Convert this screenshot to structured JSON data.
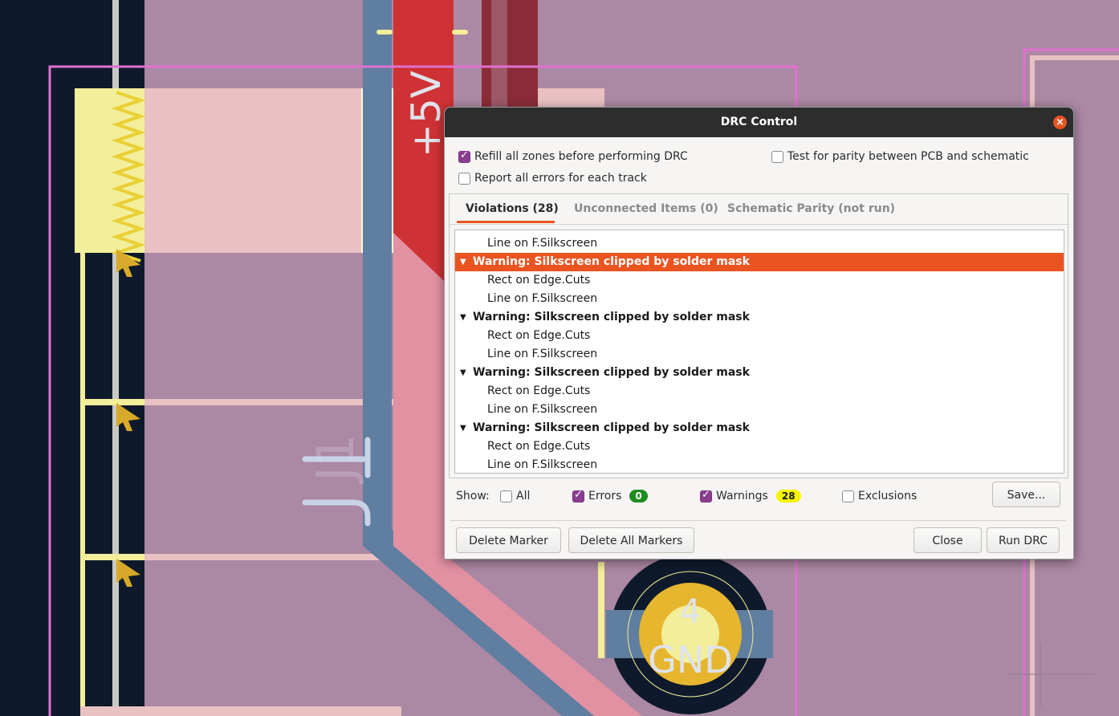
{
  "pcb": {
    "net_label_top": "+5V",
    "ref_label": "J1",
    "pad_number": "4",
    "pad_net": "GND"
  },
  "dialog": {
    "title": "DRC Control",
    "options": {
      "refill_zones": "Refill all zones before performing DRC",
      "report_all_errors": "Report all errors for each track",
      "test_parity": "Test for parity between PCB and schematic"
    },
    "tabs": [
      "Violations (28)",
      "Unconnected Items (0)",
      "Schematic Parity (not run)"
    ],
    "list": {
      "partial_top": "Line on F.Silkscreen",
      "items": [
        {
          "title": "Warning: Silkscreen clipped by solder mask",
          "children": [
            "Rect on Edge.Cuts",
            "Line on F.Silkscreen"
          ]
        },
        {
          "title": "Warning: Silkscreen clipped by solder mask",
          "children": [
            "Rect on Edge.Cuts",
            "Line on F.Silkscreen"
          ]
        },
        {
          "title": "Warning: Silkscreen clipped by solder mask",
          "children": [
            "Rect on Edge.Cuts",
            "Line on F.Silkscreen"
          ]
        },
        {
          "title": "Warning: Silkscreen clipped by solder mask",
          "children": [
            "Rect on Edge.Cuts",
            "Line on F.Silkscreen"
          ]
        }
      ]
    },
    "show": {
      "label": "Show:",
      "all": "All",
      "errors": "Errors",
      "errors_count": "0",
      "warnings": "Warnings",
      "warnings_count": "28",
      "exclusions": "Exclusions"
    },
    "buttons": {
      "save": "Save...",
      "delete_marker": "Delete Marker",
      "delete_all_markers": "Delete All Markers",
      "close": "Close",
      "run_drc": "Run DRC"
    },
    "colors": {
      "accent": "#e95420",
      "check_on": "#8a3e8f",
      "errors_badge": "#1e8c1e",
      "warnings_badge": "#f5f500"
    }
  }
}
